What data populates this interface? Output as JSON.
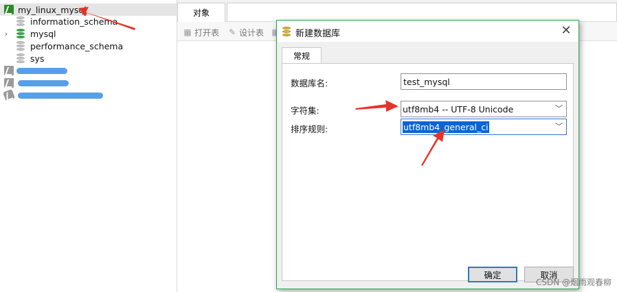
{
  "sidebar": {
    "connection": "my_linux_mysql",
    "databases": [
      {
        "name": "information_schema",
        "icon": "database-gray-icon"
      },
      {
        "name": "mysql",
        "icon": "database-green-icon"
      },
      {
        "name": "performance_schema",
        "icon": "database-gray-icon"
      },
      {
        "name": "sys",
        "icon": "database-gray-icon"
      }
    ],
    "expander_glyph": "›"
  },
  "main": {
    "tab_label": "对象",
    "toolbar": {
      "open_table": "打开表",
      "design_table": "设计表"
    }
  },
  "dialog": {
    "title": "新建数据库",
    "close_glyph": "✕",
    "tab_label": "常规",
    "fields": {
      "db_name_label": "数据库名:",
      "db_name_value": "test_mysql",
      "charset_label": "字符集:",
      "charset_value": "utf8mb4 -- UTF-8 Unicode",
      "collation_label": "排序规则:",
      "collation_value": "utf8mb4_general_ci"
    },
    "ok_button": "确定",
    "cancel_button": "取消"
  },
  "watermark": "CSDN @烟雨观春柳",
  "colors": {
    "dialog_border": "#1fa84a",
    "annotation_arrow": "#e5332a",
    "selection": "#0a64d6"
  }
}
